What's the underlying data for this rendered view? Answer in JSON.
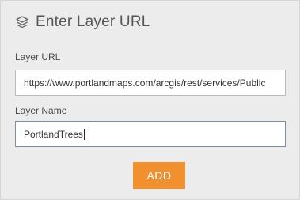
{
  "panel": {
    "title": "Enter Layer URL",
    "icon": "layers-icon"
  },
  "fields": {
    "url": {
      "label": "Layer URL",
      "value": "https://www.portlandmaps.com/arcgis/rest/services/Public"
    },
    "name": {
      "label": "Layer Name",
      "value": "PortlandTrees"
    }
  },
  "actions": {
    "add_label": "ADD"
  },
  "colors": {
    "accent": "#f0902f",
    "background": "#ececec"
  }
}
